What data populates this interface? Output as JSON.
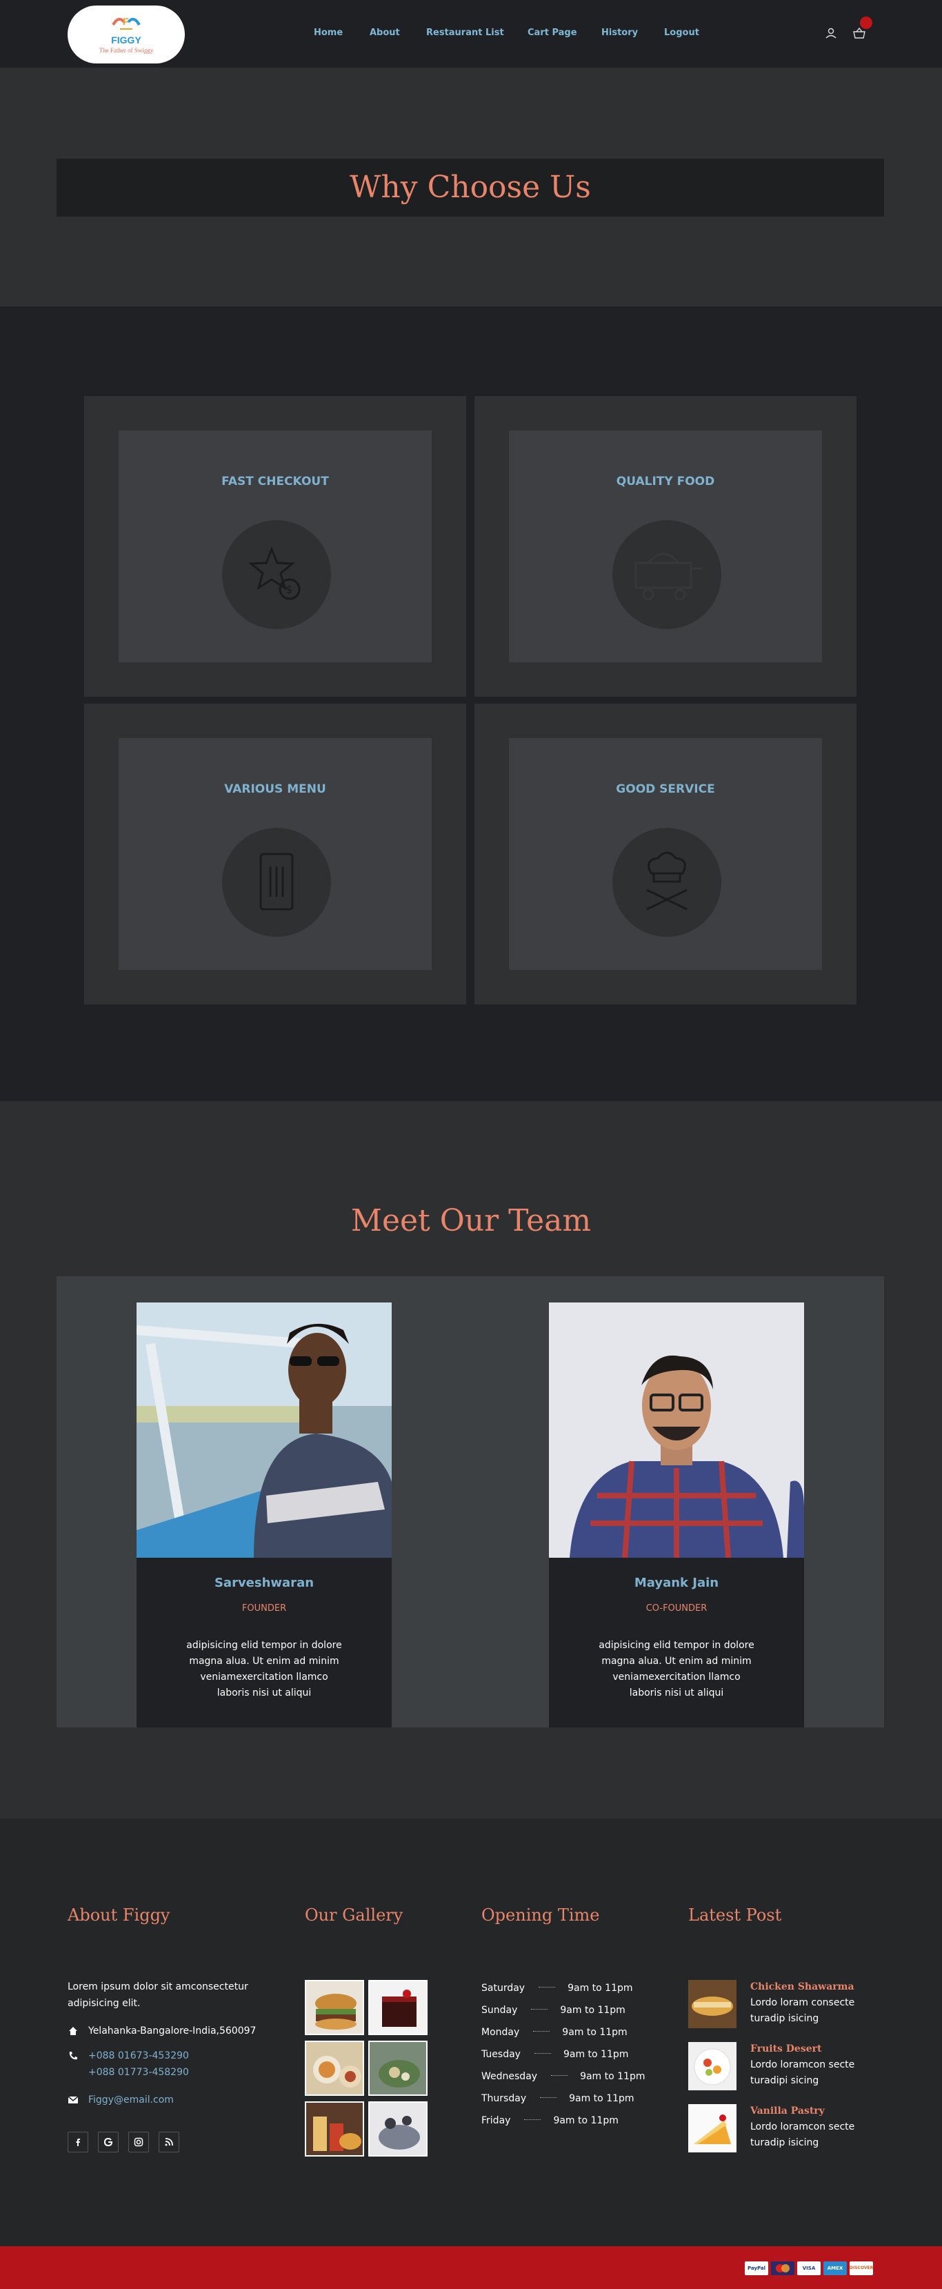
{
  "header": {
    "logo": {
      "name": "FIGGY",
      "tagline": "The Father of Swiggy"
    },
    "nav": [
      "Home",
      "About",
      "Restaurant List",
      "Cart Page",
      "History",
      "Logout"
    ]
  },
  "hero": {
    "title": "Why Choose Us"
  },
  "features": [
    {
      "title": "FAST CHECKOUT",
      "icon": "star-coin-icon"
    },
    {
      "title": "QUALITY FOOD",
      "icon": "food-cart-icon"
    },
    {
      "title": "VARIOUS MENU",
      "icon": "menu-phone-icon"
    },
    {
      "title": "GOOD SERVICE",
      "icon": "chef-hat-icon"
    }
  ],
  "team": {
    "title": "Meet Our Team",
    "members": [
      {
        "name": "Sarveshwaran",
        "role": "FOUNDER",
        "bio": "adipisicing elid tempor in dolore magna alua. Ut enim ad minim veniamexercitation llamco laboris nisi ut aliqui"
      },
      {
        "name": "Mayank Jain",
        "role": "CO-FOUNDER",
        "bio": "adipisicing elid tempor in dolore magna alua. Ut enim ad minim veniamexercitation llamco laboris nisi ut aliqui"
      }
    ]
  },
  "footer": {
    "about": {
      "title": "About Figgy",
      "text": "Lorem ipsum dolor sit amconsectetur adipisicing elit.",
      "address": "Yelahanka-Bangalore-India,560097",
      "phone1": "+088 01673-453290",
      "phone2": "+088 01773-458290",
      "email": "Figgy@email.com"
    },
    "gallery": {
      "title": "Our Gallery"
    },
    "opening": {
      "title": "Opening Time",
      "rows": [
        {
          "day": "Saturday",
          "time": "9am to 11pm"
        },
        {
          "day": "Sunday",
          "time": "9am to 11pm"
        },
        {
          "day": "Monday",
          "time": "9am to 11pm"
        },
        {
          "day": "Tuesday",
          "time": "9am to 11pm"
        },
        {
          "day": "Wednesday",
          "time": "9am to 11pm"
        },
        {
          "day": "Thursday",
          "time": "9am to 11pm"
        },
        {
          "day": "Friday",
          "time": "9am to 11pm"
        }
      ]
    },
    "posts": {
      "title": "Latest Post",
      "items": [
        {
          "title": "Chicken Shawarma",
          "text": "Lordo loram consecte turadip isicing"
        },
        {
          "title": "Fruits Desert",
          "text": "Lordo loramcon secte turadipi sicing"
        },
        {
          "title": "Vanilla Pastry",
          "text": "Lordo loramcon secte turadip isicing"
        }
      ]
    }
  },
  "payments": [
    "PayPal",
    "MasterCard",
    "VISA",
    "AMEX",
    "DISCOVER"
  ],
  "colors": {
    "accent": "#e8856a",
    "link": "#7fb2cf",
    "bar": "#b5141a"
  }
}
